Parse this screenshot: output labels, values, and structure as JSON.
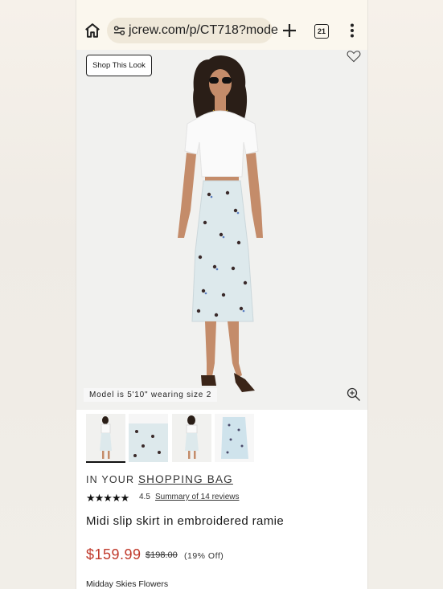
{
  "browser": {
    "url": "jcrew.com/p/CT718?mode",
    "tab_count": "21"
  },
  "hero": {
    "shop_look_label": "Shop This Look",
    "model_info": "Model is 5'10\" wearing size 2"
  },
  "product": {
    "bag_prefix": "IN YOUR",
    "bag_link": "SHOPPING BAG",
    "stars": "★★★★★",
    "rating": "4.5",
    "reviews_link": "Summary of 14 reviews",
    "title": "Midi slip skirt in embroidered ramie",
    "sale_price": "$159.99",
    "original_price": "$198.00",
    "discount": "(19% Off)",
    "color_name": "Midday Skies Flowers"
  },
  "colors": {
    "sale": "#c0392b",
    "address_bar_bg": "#fbf7ee",
    "skirt": "#dde9ec"
  },
  "icons": [
    "home-icon",
    "site-settings-icon",
    "plus-icon",
    "tabs-icon",
    "more-vert-icon",
    "heart-icon",
    "zoom-in-icon"
  ]
}
